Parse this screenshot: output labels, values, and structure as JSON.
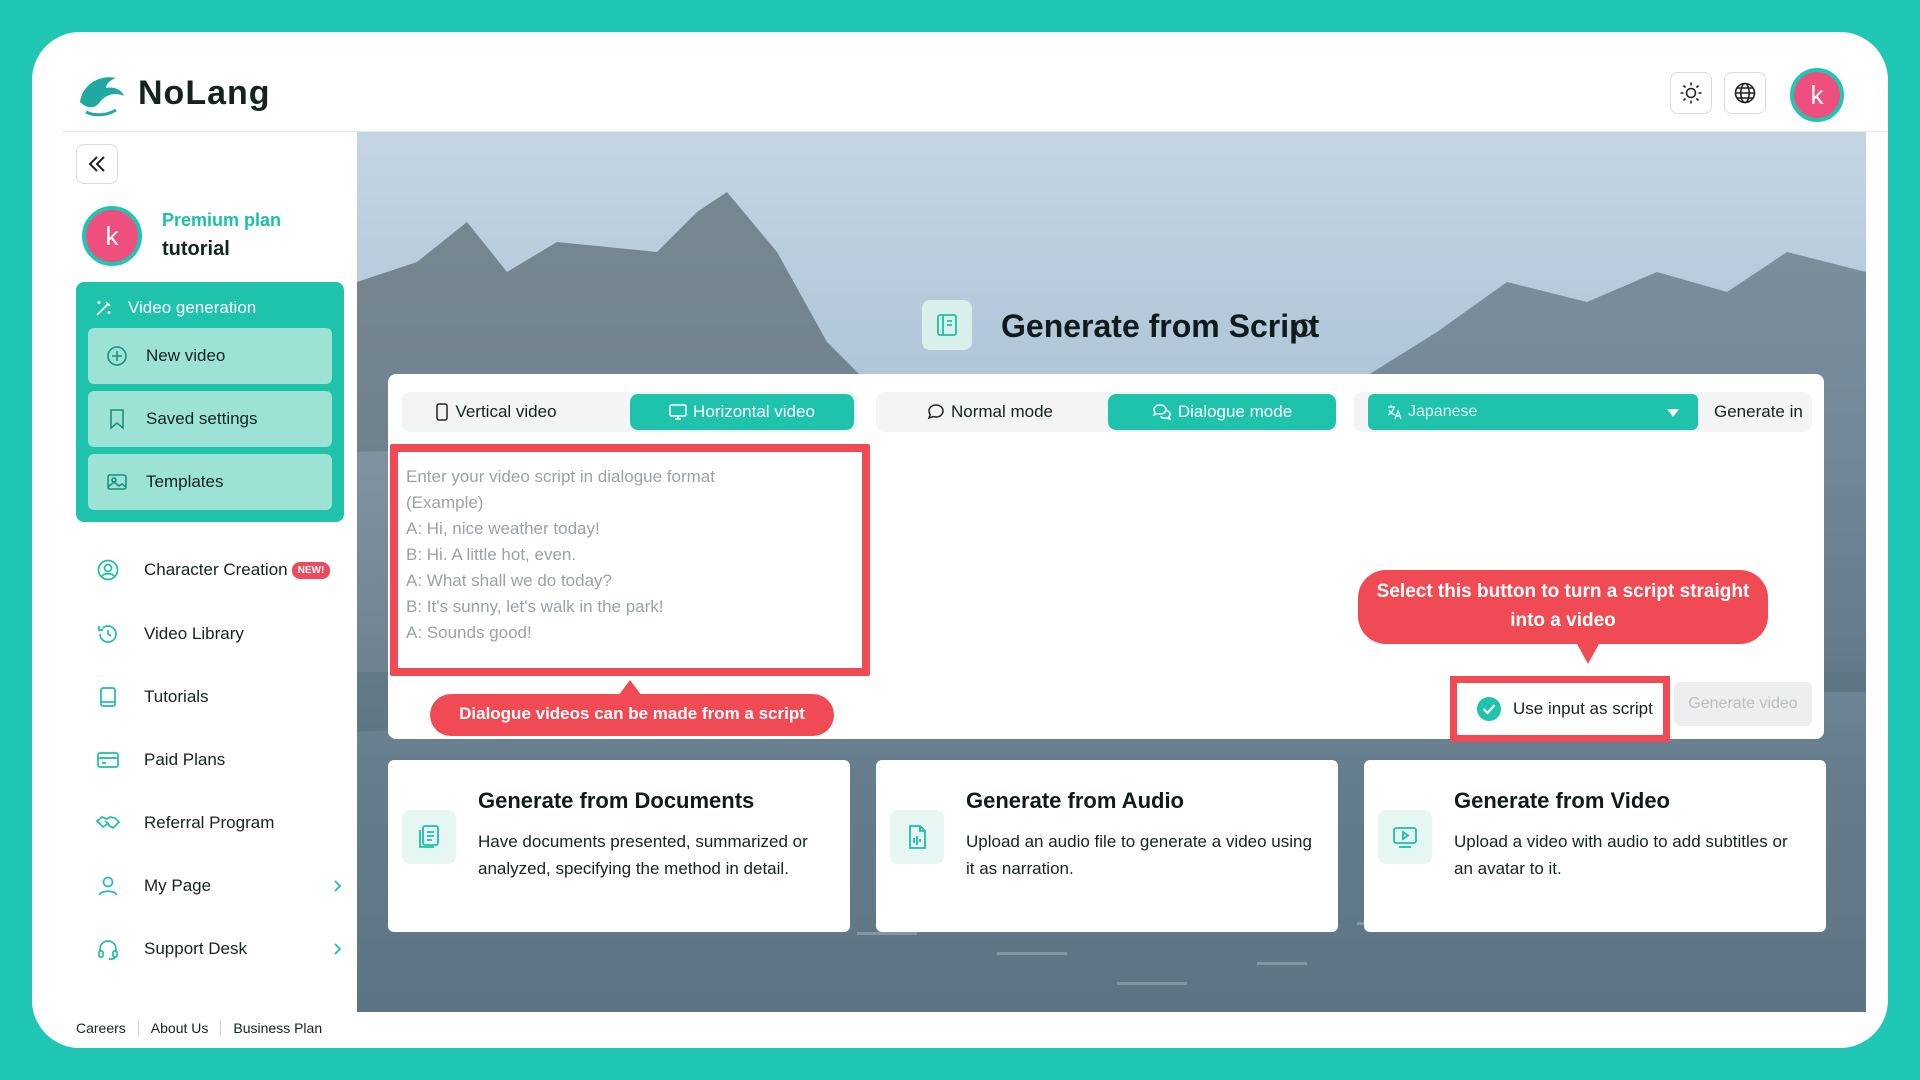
{
  "header": {
    "brand": "NoLang",
    "avatar_letter": "k",
    "icons": [
      "sun-icon",
      "globe-icon"
    ]
  },
  "sidebar": {
    "plan": {
      "avatar_letter": "k",
      "plan_name": "Premium plan",
      "user_name": "tutorial"
    },
    "video_generation": {
      "title": "Video generation",
      "items": [
        {
          "label": "New video",
          "icon": "plus-circle-icon"
        },
        {
          "label": "Saved settings",
          "icon": "bookmark-icon"
        },
        {
          "label": "Templates",
          "icon": "image-icon"
        }
      ]
    },
    "nav": [
      {
        "label": "Character Creation",
        "icon": "character-icon",
        "badge": "NEW!"
      },
      {
        "label": "Video Library",
        "icon": "history-icon"
      },
      {
        "label": "Tutorials",
        "icon": "book-icon"
      },
      {
        "label": "Paid Plans",
        "icon": "card-icon"
      },
      {
        "label": "Referral Program",
        "icon": "handshake-icon"
      },
      {
        "label": "My Page",
        "icon": "user-icon",
        "has_chevron": true
      },
      {
        "label": "Support Desk",
        "icon": "headset-icon",
        "has_chevron": true
      }
    ],
    "footer": [
      "Careers",
      "About Us",
      "Business Plan"
    ]
  },
  "main": {
    "title": "Generate from Script",
    "orientation": {
      "options": [
        "Vertical video",
        "Horizontal video"
      ],
      "selected": "Horizontal video"
    },
    "mode": {
      "options": [
        "Normal mode",
        "Dialogue mode"
      ],
      "selected": "Dialogue mode"
    },
    "language": {
      "value": "Japanese",
      "suffix": "Generate in"
    },
    "script_placeholder": "Enter your video script in dialogue format\n(Example)\nA: Hi, nice weather today!\nB: Hi. A little hot, even.\nA: What shall we do today?\nB: It's sunny, let's walk in the park!\nA: Sounds good!",
    "tip_left": "Dialogue videos can be made from a script",
    "tip_right": "Select this button to turn a script straight into a video",
    "use_input_label": "Use input as script",
    "use_input_checked": true,
    "generate_button": "Generate video",
    "cards": [
      {
        "title": "Generate from Documents",
        "desc": "Have documents presented, summarized or analyzed, specifying the method in detail.",
        "icon": "document-icon"
      },
      {
        "title": "Generate from Audio",
        "desc": "Upload an audio file to generate a video using it as narration.",
        "icon": "audio-file-icon"
      },
      {
        "title": "Generate from Video",
        "desc": "Upload a video with audio to add subtitles or an avatar to it.",
        "icon": "video-play-icon"
      }
    ]
  },
  "colors": {
    "accent": "#1fc2aa",
    "highlight": "#f04a54",
    "avatar": "#ef4f7e"
  }
}
